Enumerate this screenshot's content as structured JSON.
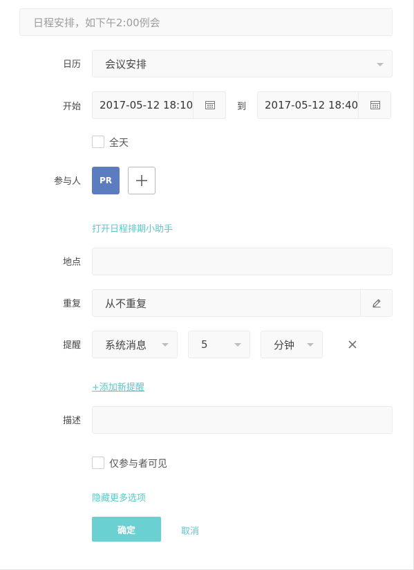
{
  "title_input": {
    "placeholder": "日程安排，如下午2:00例会"
  },
  "calendar": {
    "label": "日历",
    "value": "会议安排"
  },
  "start": {
    "label": "开始",
    "start_value": "2017-05-12 18:10",
    "separator": "到",
    "end_value": "2017-05-12 18:40"
  },
  "all_day": {
    "label": "全天",
    "checked": false
  },
  "participants": {
    "label": "参与人",
    "avatars": [
      "PR"
    ],
    "assistant_link": "打开日程排期小助手"
  },
  "location": {
    "label": "地点",
    "value": ""
  },
  "repeat": {
    "label": "重复",
    "value": "从不重复"
  },
  "reminder": {
    "label": "提醒",
    "type": "系统消息",
    "amount": "5",
    "unit": "分钟",
    "add_link": "+添加新提醒"
  },
  "description": {
    "label": "描述",
    "value": ""
  },
  "visibility": {
    "label": "仅参与者可见",
    "checked": false
  },
  "more_options_link": "隐藏更多选项",
  "actions": {
    "confirm": "确定",
    "cancel": "取消"
  },
  "colors": {
    "accent": "#5cc6c8",
    "confirm_bg": "#6ad0d1",
    "avatar_bg": "#5b7dbf"
  }
}
